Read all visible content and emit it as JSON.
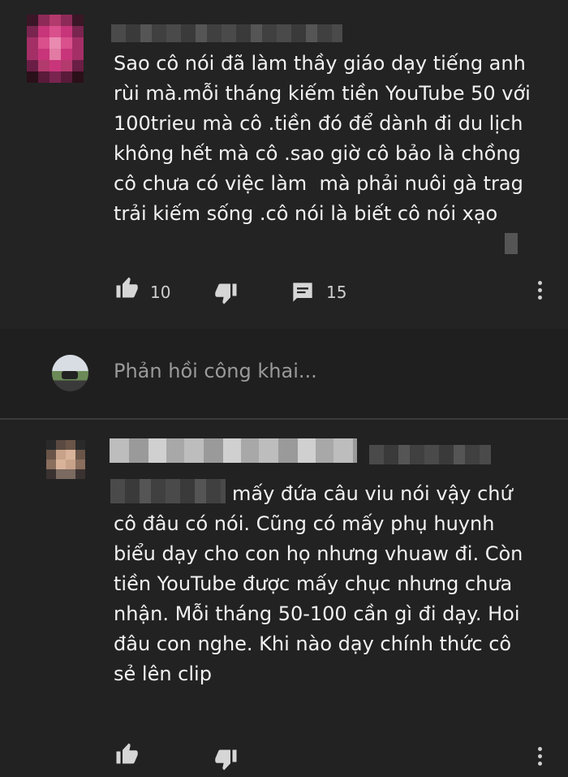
{
  "comment": {
    "text": "Sao cô nói đã làm thầy giáo dạy tiếng anh\nrùi mà.mỗi tháng kiếm tiền YouTube 50 với\n100trieu mà cô .tiền đó để dành đi du lịch\nkhông hết mà cô .sao giờ cô bảo là chồng\ncô chưa có việc làm  mà phải nuôi gà trag\ntrải kiếm sống .cô nói là biết cô nói xạo",
    "like_count": "10",
    "reply_count": "15"
  },
  "reply_box": {
    "placeholder": "Phản hồi công khai..."
  },
  "reply": {
    "text": "mấy đứa câu viu nói vậy chứ\ncô đâu có nói. Cũng có mấy phụ huynh\nbiểu dạy cho con họ nhưng vhuaw đi. Còn\ntiền YouTube được mấy chục nhưng chưa\nnhận. Mỗi tháng 50-100 cần gì đi dạy. Hoi\nđâu con nghe. Khi nào dạy chính thức cô\nsẻ lên clip"
  },
  "icons": {
    "like": "thumbs-up-icon",
    "dislike": "thumbs-down-icon",
    "reply": "comment-icon",
    "more": "more-vertical-icon"
  },
  "colors": {
    "background": "#1f1f1f",
    "text": "#f2f2f2",
    "muted": "#9a9a9a",
    "avatar_accent": "#c8357a"
  }
}
